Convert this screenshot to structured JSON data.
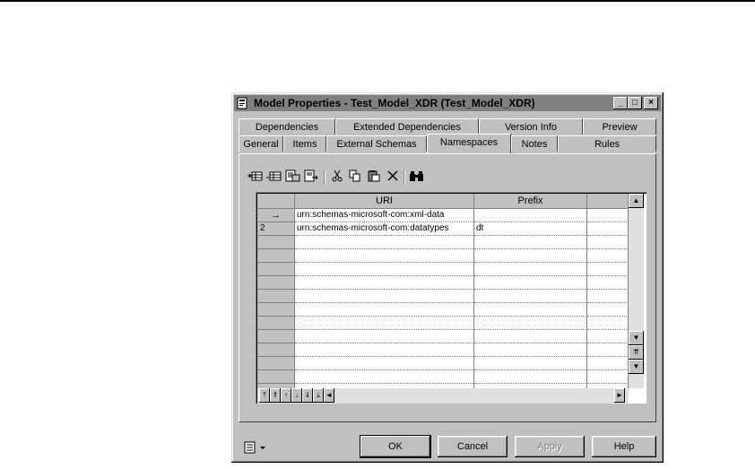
{
  "window": {
    "title": "Model Properties - Test_Model_XDR (Test_Model_XDR)",
    "controls": [
      "_",
      "□",
      "×"
    ]
  },
  "tabs": {
    "row_back": [
      "Dependencies",
      "Extended Dependencies",
      "Version Info",
      "Preview"
    ],
    "row_front": [
      "General",
      "Items",
      "External Schemas",
      "Namespaces",
      "Notes",
      "Rules"
    ],
    "active": "Namespaces"
  },
  "toolbar": {
    "icons": [
      "insert-row-icon",
      "add-row-icon",
      "add-rows-icon",
      "insert-rows-icon",
      "cut-icon",
      "copy-icon",
      "paste-icon",
      "delete-icon",
      "find-icon"
    ]
  },
  "grid": {
    "columns": [
      "URI",
      "Prefix"
    ],
    "rows": [
      {
        "marker": "→",
        "uri": "urn:schemas-microsoft-com:xml-data",
        "prefix": ""
      },
      {
        "marker": "2",
        "uri": "urn:schemas-microsoft-com:datatypes",
        "prefix": "dt"
      }
    ],
    "empty_rows": 12
  },
  "buttons": {
    "ok": "OK",
    "cancel": "Cancel",
    "apply": "Apply",
    "help": "Help"
  }
}
